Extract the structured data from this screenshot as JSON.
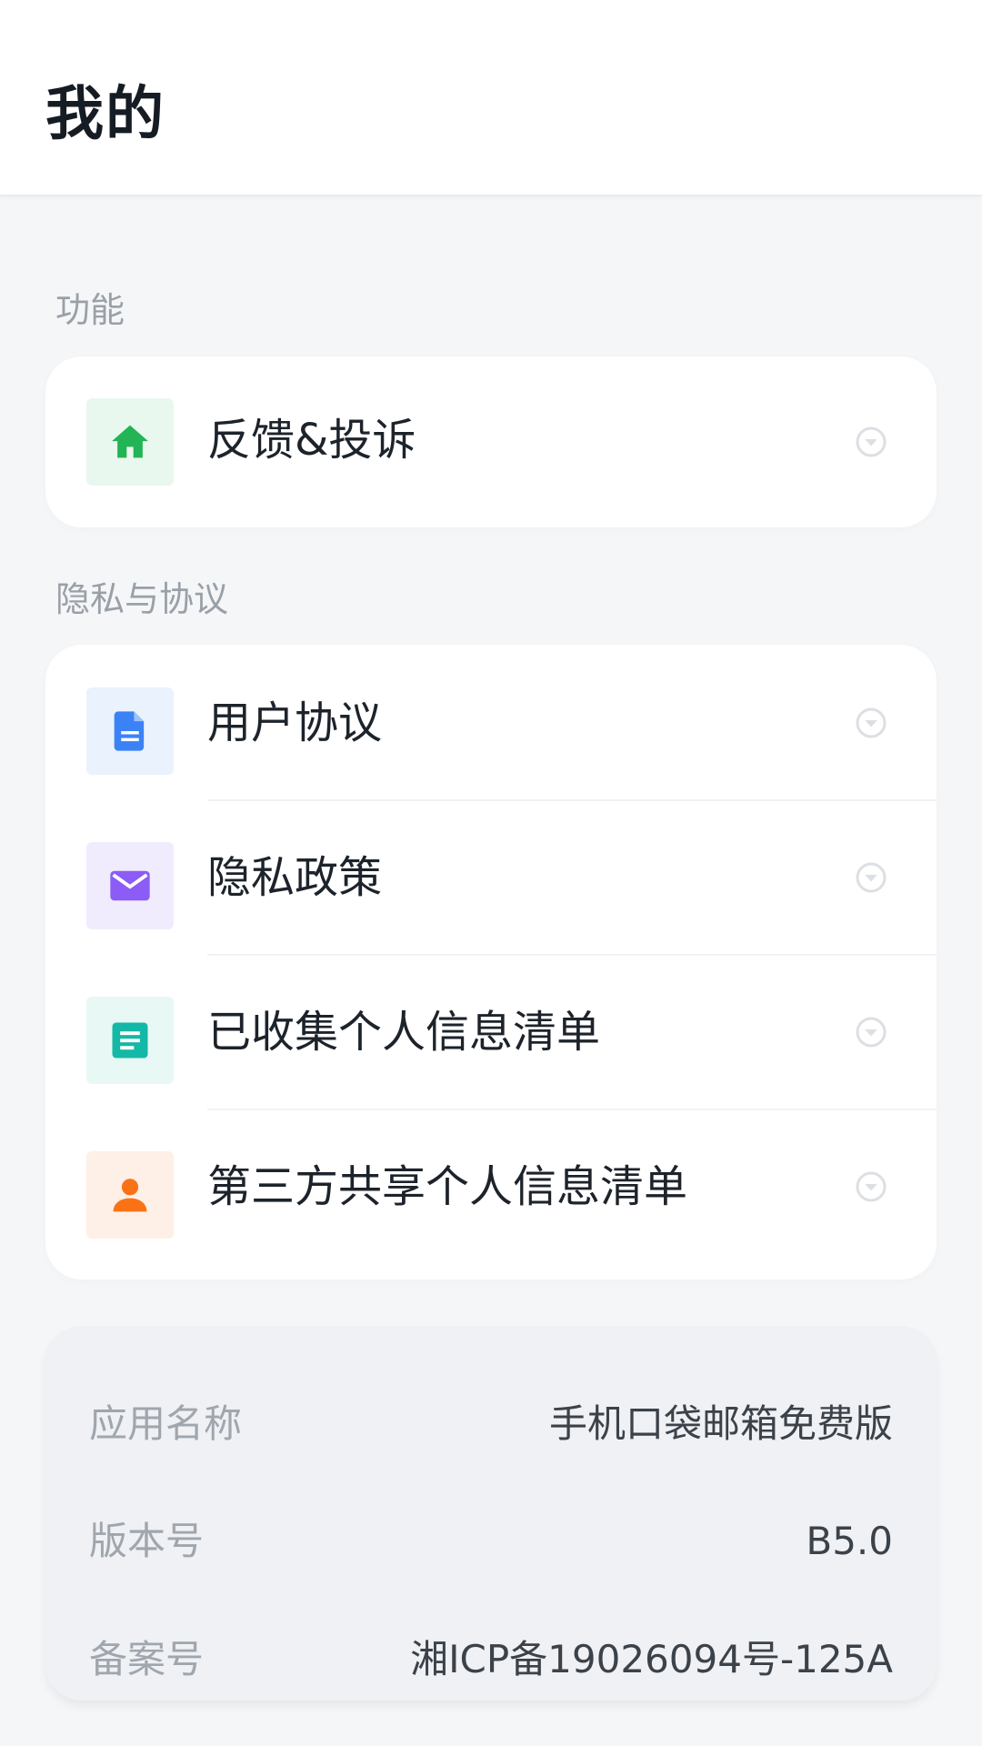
{
  "header": {
    "title": "我的"
  },
  "sections": {
    "features_label": "功能",
    "privacy_label": "隐私与协议"
  },
  "features": {
    "items": [
      {
        "label": "反馈&投诉",
        "icon": "home-icon",
        "color": "#22b455",
        "bg": "#e9f8ee"
      }
    ]
  },
  "privacy": {
    "items": [
      {
        "label": "用户协议",
        "icon": "document-icon",
        "color": "#3b82f6",
        "bg": "#eaf2fd"
      },
      {
        "label": "隐私政策",
        "icon": "mail-icon",
        "color": "#8b5cf6",
        "bg": "#f1ecfd"
      },
      {
        "label": "已收集个人信息清单",
        "icon": "list-icon",
        "color": "#14b8a6",
        "bg": "#e8f8f5"
      },
      {
        "label": "第三方共享个人信息清单",
        "icon": "person-icon",
        "color": "#f97316",
        "bg": "#fef0e6"
      }
    ]
  },
  "app_info": {
    "rows": [
      {
        "key": "应用名称",
        "value": "手机口袋邮箱免费版"
      },
      {
        "key": "版本号",
        "value": "B5.0"
      },
      {
        "key": "备案号",
        "value": "湘ICP备19026094号-125A"
      }
    ]
  }
}
